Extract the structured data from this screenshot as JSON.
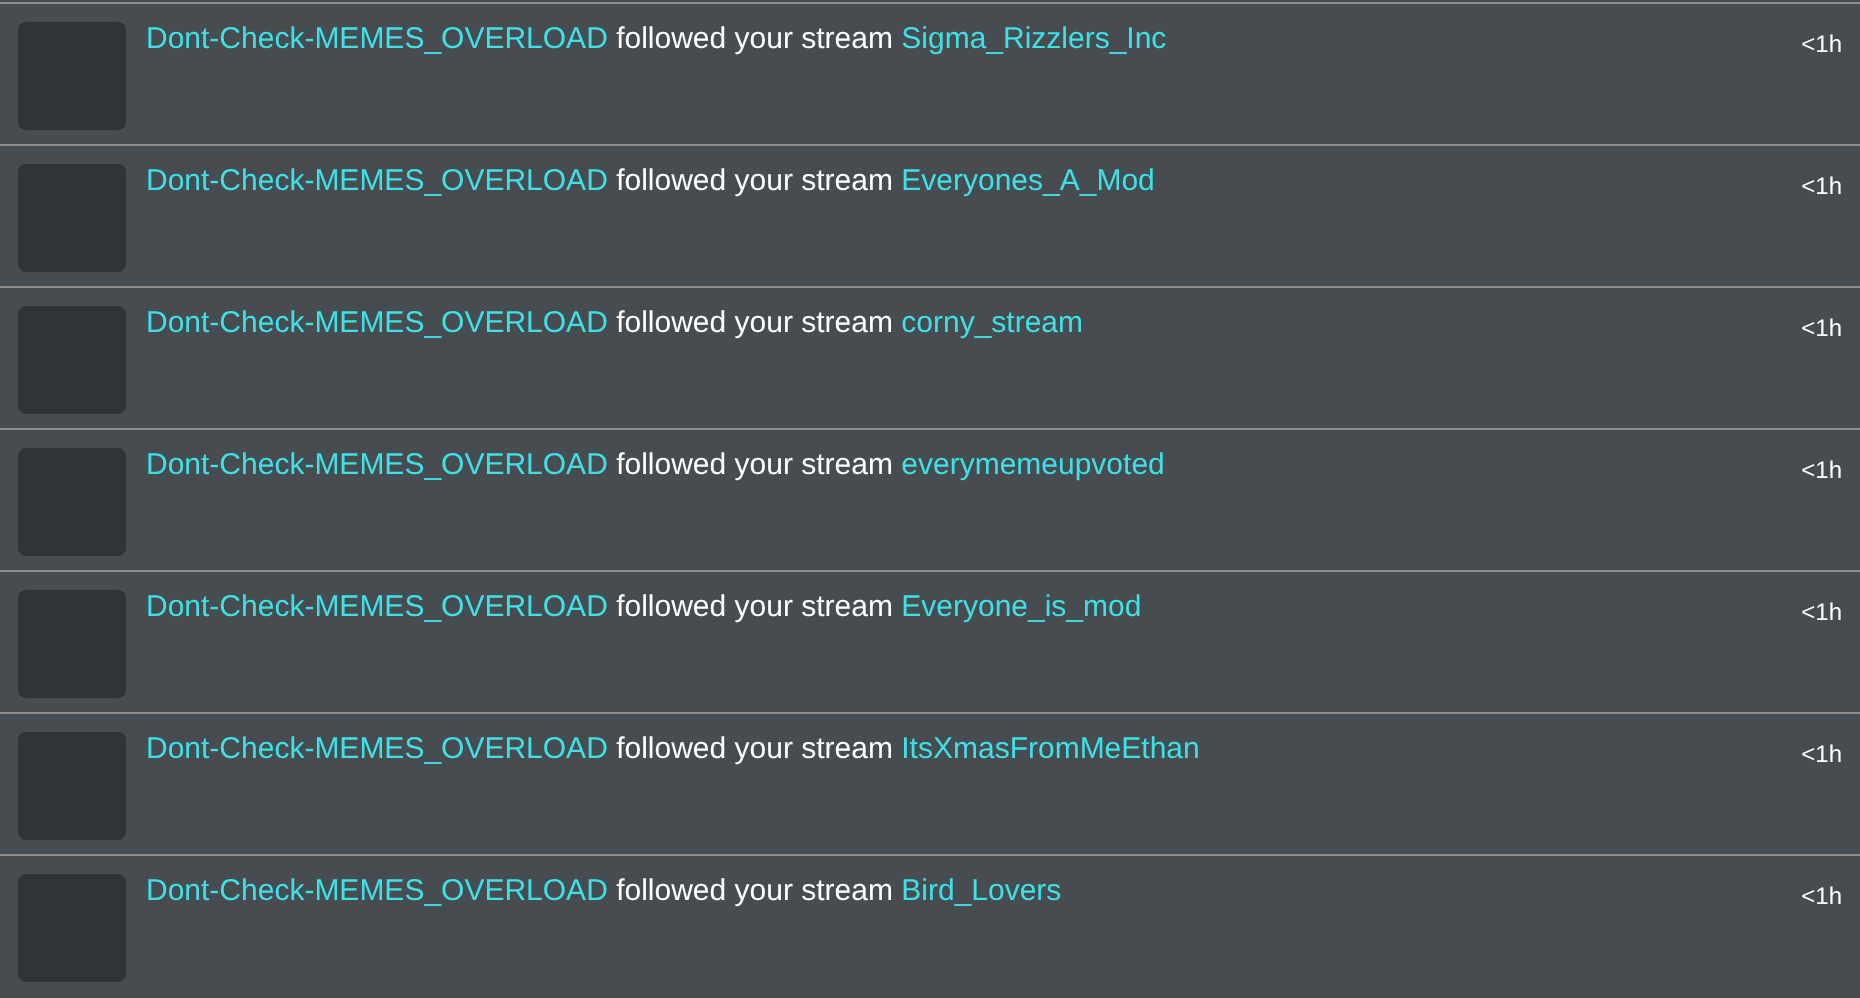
{
  "notifications": [
    {
      "user": "Dont-Check-MEMES_OVERLOAD",
      "action": "followed your stream",
      "stream": "Sigma_Rizzlers_Inc",
      "time": "<1h"
    },
    {
      "user": "Dont-Check-MEMES_OVERLOAD",
      "action": "followed your stream",
      "stream": "Everyones_A_Mod",
      "time": "<1h"
    },
    {
      "user": "Dont-Check-MEMES_OVERLOAD",
      "action": "followed your stream",
      "stream": "corny_stream",
      "time": "<1h"
    },
    {
      "user": "Dont-Check-MEMES_OVERLOAD",
      "action": "followed your stream",
      "stream": "everymemeupvoted",
      "time": "<1h"
    },
    {
      "user": "Dont-Check-MEMES_OVERLOAD",
      "action": "followed your stream",
      "stream": "Everyone_is_mod",
      "time": "<1h"
    },
    {
      "user": "Dont-Check-MEMES_OVERLOAD",
      "action": "followed your stream",
      "stream": "ItsXmasFromMeEthan",
      "time": "<1h"
    },
    {
      "user": "Dont-Check-MEMES_OVERLOAD",
      "action": "followed your stream",
      "stream": "Bird_Lovers",
      "time": "<1h"
    }
  ]
}
